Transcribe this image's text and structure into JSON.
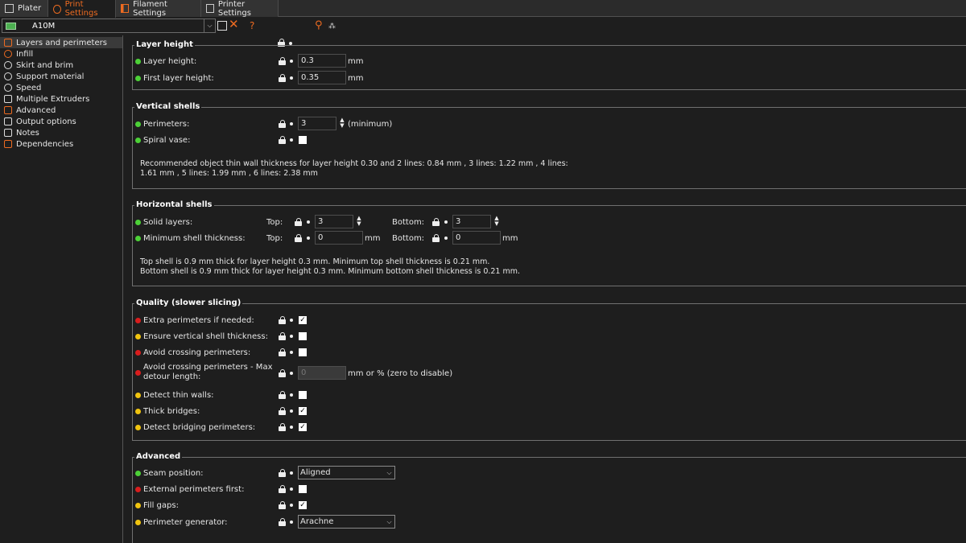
{
  "tabs": [
    {
      "label": "Plater",
      "icon": "plater-icon"
    },
    {
      "label": "Print Settings",
      "icon": "gear-icon",
      "active": true
    },
    {
      "label": "Filament Settings",
      "icon": "filament-icon"
    },
    {
      "label": "Printer Settings",
      "icon": "printer-icon"
    }
  ],
  "toolbar": {
    "preset_name": "A10M",
    "icons": [
      "save-icon",
      "delete-icon",
      "help-icon",
      "lock-icon",
      "bullet-icon",
      "search-icon",
      "compare-icon"
    ],
    "help_glyph": "?"
  },
  "sidebar": {
    "items": [
      {
        "label": "Layers and perimeters",
        "selected": true
      },
      {
        "label": "Infill"
      },
      {
        "label": "Skirt and brim"
      },
      {
        "label": "Support material"
      },
      {
        "label": "Speed"
      },
      {
        "label": "Multiple Extruders"
      },
      {
        "label": "Advanced"
      },
      {
        "label": "Output options"
      },
      {
        "label": "Notes"
      },
      {
        "label": "Dependencies"
      }
    ]
  },
  "colors": {
    "accent": "#ed6b21",
    "green": "#4cd137",
    "yellow": "#f1c40f",
    "red": "#d91d1d"
  },
  "groups": {
    "layer_height": {
      "title": "Layer height",
      "layer_height": {
        "label": "Layer height:",
        "value": "0.3",
        "unit": "mm"
      },
      "first_layer_height": {
        "label": "First layer height:",
        "value": "0.35",
        "unit": "mm"
      }
    },
    "vertical_shells": {
      "title": "Vertical shells",
      "perimeters": {
        "label": "Perimeters:",
        "value": "3",
        "unit": "(minimum)"
      },
      "spiral_vase": {
        "label": "Spiral vase:",
        "checked": false
      },
      "note_line1": "Recommended object thin wall thickness for layer height 0.30 and 2 lines: 0.84 mm , 3 lines: 1.22 mm , 4 lines:",
      "note_line2": "1.61 mm , 5 lines: 1.99 mm , 6 lines: 2.38 mm"
    },
    "horizontal_shells": {
      "title": "Horizontal shells",
      "solid_layers": {
        "label": "Solid layers:",
        "top_label": "Top:",
        "top_value": "3",
        "bottom_label": "Bottom:",
        "bottom_value": "3"
      },
      "min_shell": {
        "label": "Minimum shell thickness:",
        "top_label": "Top:",
        "top_value": "0",
        "bottom_label": "Bottom:",
        "bottom_value": "0",
        "unit": "mm"
      },
      "note_line1": "Top shell is 0.9 mm thick for layer height 0.3 mm. Minimum top shell thickness is 0.21 mm.",
      "note_line2": "Bottom shell is 0.9 mm thick for layer height 0.3 mm. Minimum bottom shell thickness is 0.21 mm."
    },
    "quality": {
      "title": "Quality (slower slicing)",
      "extra_perimeters": {
        "label": "Extra perimeters if needed:",
        "checked": true
      },
      "ensure_vertical": {
        "label": "Ensure vertical shell thickness:",
        "checked": false
      },
      "avoid_crossing": {
        "label": "Avoid crossing perimeters:",
        "checked": false
      },
      "avoid_max_detour": {
        "label_line1": "Avoid crossing perimeters - Max",
        "label_line2": "detour length:",
        "value": "0",
        "unit": "mm or % (zero to disable)"
      },
      "detect_thin": {
        "label": "Detect thin walls:",
        "checked": false
      },
      "thick_bridges": {
        "label": "Thick bridges:",
        "checked": true
      },
      "detect_bridging": {
        "label": "Detect bridging perimeters:",
        "checked": true
      }
    },
    "advanced": {
      "title": "Advanced",
      "seam_position": {
        "label": "Seam position:",
        "value": "Aligned"
      },
      "external_first": {
        "label": "External perimeters first:",
        "checked": false
      },
      "fill_gaps": {
        "label": "Fill gaps:",
        "checked": true
      },
      "perimeter_generator": {
        "label": "Perimeter generator:",
        "value": "Arachne"
      }
    }
  },
  "glyphs": {
    "check": "✓",
    "dropdown": "⌵",
    "spin_up": "▲",
    "spin_down": "▼"
  }
}
